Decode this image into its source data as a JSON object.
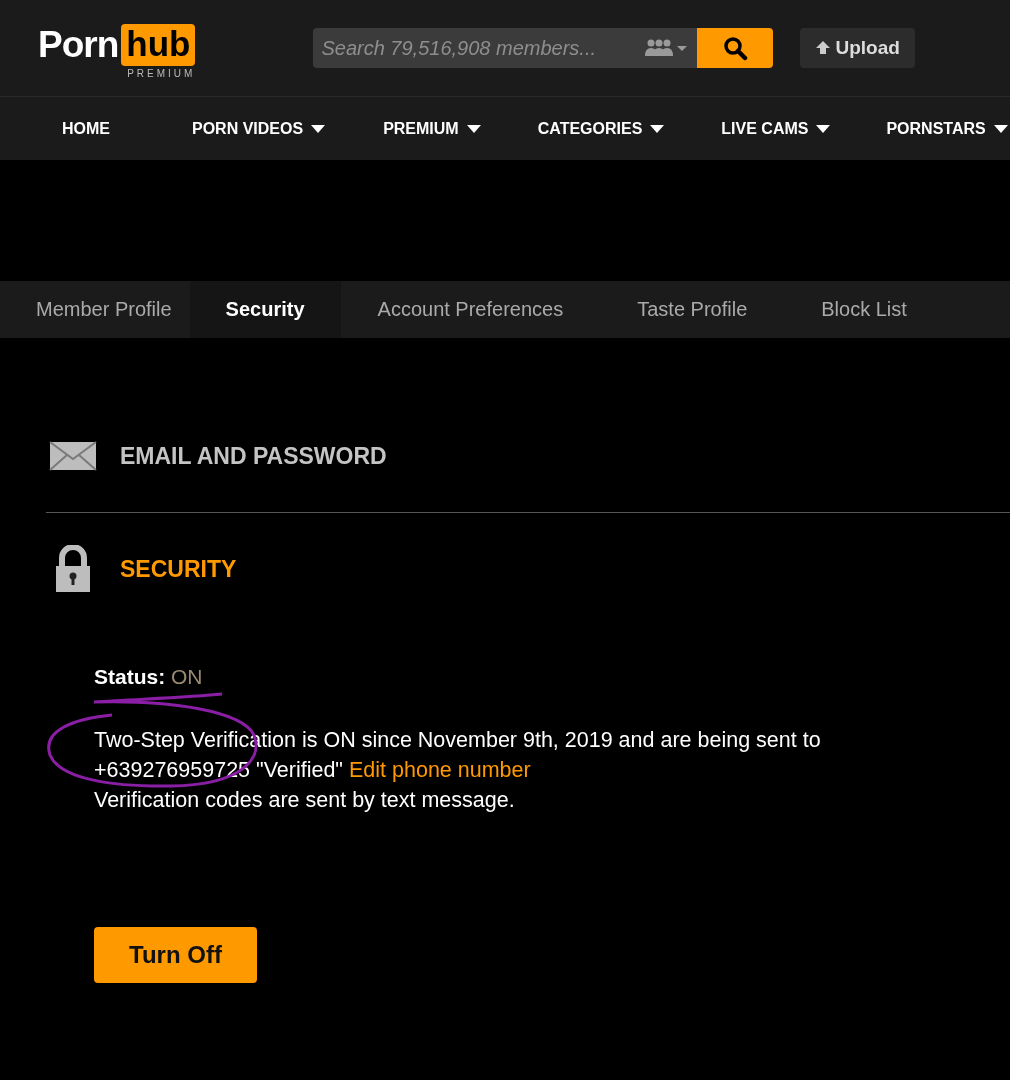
{
  "header": {
    "logo": {
      "word_1": "Porn",
      "word_2": "hub",
      "tagline": "PREMIUM"
    },
    "search": {
      "placeholder": "Search 79,516,908 members..."
    },
    "upload_button": "Upload"
  },
  "nav": [
    {
      "label": "HOME",
      "dropdown": false
    },
    {
      "label": "PORN VIDEOS",
      "dropdown": true
    },
    {
      "label": "PREMIUM",
      "dropdown": true
    },
    {
      "label": "CATEGORIES",
      "dropdown": true
    },
    {
      "label": "LIVE CAMS",
      "dropdown": true
    },
    {
      "label": "PORNSTARS",
      "dropdown": true
    }
  ],
  "tabs": [
    {
      "label": "Member Profile",
      "selected": false
    },
    {
      "label": "Security",
      "selected": true
    },
    {
      "label": "Account Preferences",
      "selected": false
    },
    {
      "label": "Taste Profile",
      "selected": false
    },
    {
      "label": "Block List",
      "selected": false
    }
  ],
  "sections": [
    {
      "title": "EMAIL AND PASSWORD",
      "selected": false
    },
    {
      "title": "SECURITY",
      "selected": true
    }
  ],
  "security": {
    "status_label": "Status:",
    "status_value": "ON",
    "message": "Two-Step Verification is ON since November 9th, 2019 and are being sent to",
    "phone": "+639276959725 \"Verified\"",
    "edit_link": "Edit phone number",
    "note": "Verification codes are sent by text message.",
    "button": "Turn Off"
  }
}
